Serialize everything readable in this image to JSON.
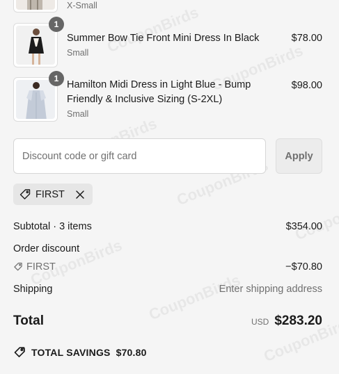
{
  "items": [
    {
      "name": "",
      "variant": "X-Small",
      "price": "",
      "quantity": "",
      "image_icon": "dress-photo-partial"
    },
    {
      "name": "Summer Bow Tie Front Mini Dress In Black",
      "variant": "Small",
      "price": "$78.00",
      "quantity": "1",
      "image_icon": "black-dress-photo"
    },
    {
      "name": "Hamilton Midi Dress in Light Blue - Bump Friendly & Inclusive Sizing (S-2XL)",
      "variant": "Small",
      "price": "$98.00",
      "quantity": "1",
      "image_icon": "light-blue-dress-photo"
    }
  ],
  "discount": {
    "placeholder": "Discount code or gift card",
    "value": "",
    "apply_label": "Apply"
  },
  "applied_code": {
    "code": "FIRST",
    "tag_icon": "tag-icon",
    "remove_icon": "close-icon"
  },
  "summary": {
    "subtotal_label": "Subtotal · 3 items",
    "subtotal_value": "$354.00",
    "order_discount_label": "Order discount",
    "discount_code": "FIRST",
    "discount_value": "−$70.80",
    "shipping_label": "Shipping",
    "shipping_value": "Enter shipping address",
    "total_label": "Total",
    "currency": "USD",
    "total_value": "$283.20",
    "savings_label": "TOTAL SAVINGS",
    "savings_value": "$70.80"
  },
  "watermark": "CouponBirds",
  "colors": {
    "background": "#f5f5f5",
    "text": "#1a1a1a",
    "muted": "#707070",
    "quantity_badge": "#666666",
    "chip_bg": "#e6e6e6"
  }
}
